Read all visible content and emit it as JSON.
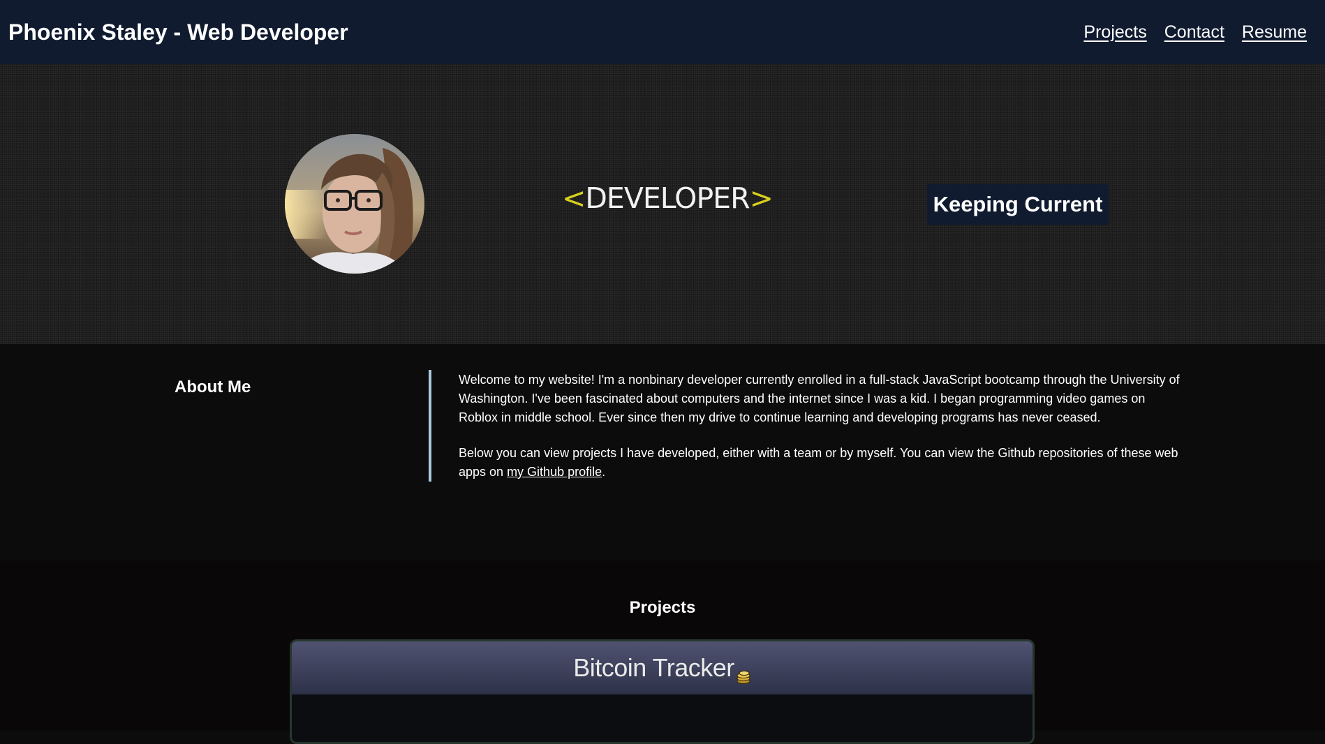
{
  "header": {
    "title": "Phoenix Staley - Web Developer",
    "nav": [
      {
        "label": "Projects"
      },
      {
        "label": "Contact"
      },
      {
        "label": "Resume"
      }
    ]
  },
  "hero": {
    "logo_open": "<",
    "logo_word": "DEVELOPER",
    "logo_close": ">",
    "keeping_current": "Keeping Current"
  },
  "about": {
    "heading": "About Me",
    "paragraph1": "Welcome to my website! I'm a nonbinary developer currently enrolled in a full-stack JavaScript bootcamp through the University of Washington. I've been fascinated about computers and the internet since I was a kid. I began programming video games on Roblox in middle school. Ever since then my drive to continue learning and developing programs has never ceased.",
    "paragraph2_before": "Below you can view projects I have developed, either with a team or by myself. You can view the Github repositories of these web apps on ",
    "paragraph2_link": "my Github profile",
    "paragraph2_after": "."
  },
  "projects": {
    "heading": "Projects",
    "items": [
      {
        "title": "Bitcoin Tracker",
        "icon": "coins-icon"
      }
    ]
  },
  "colors": {
    "header_bg": "#101b30",
    "hero_bg": "#1d1d1d",
    "divider": "#a9c9de",
    "accent_bracket": "#d8d020"
  }
}
